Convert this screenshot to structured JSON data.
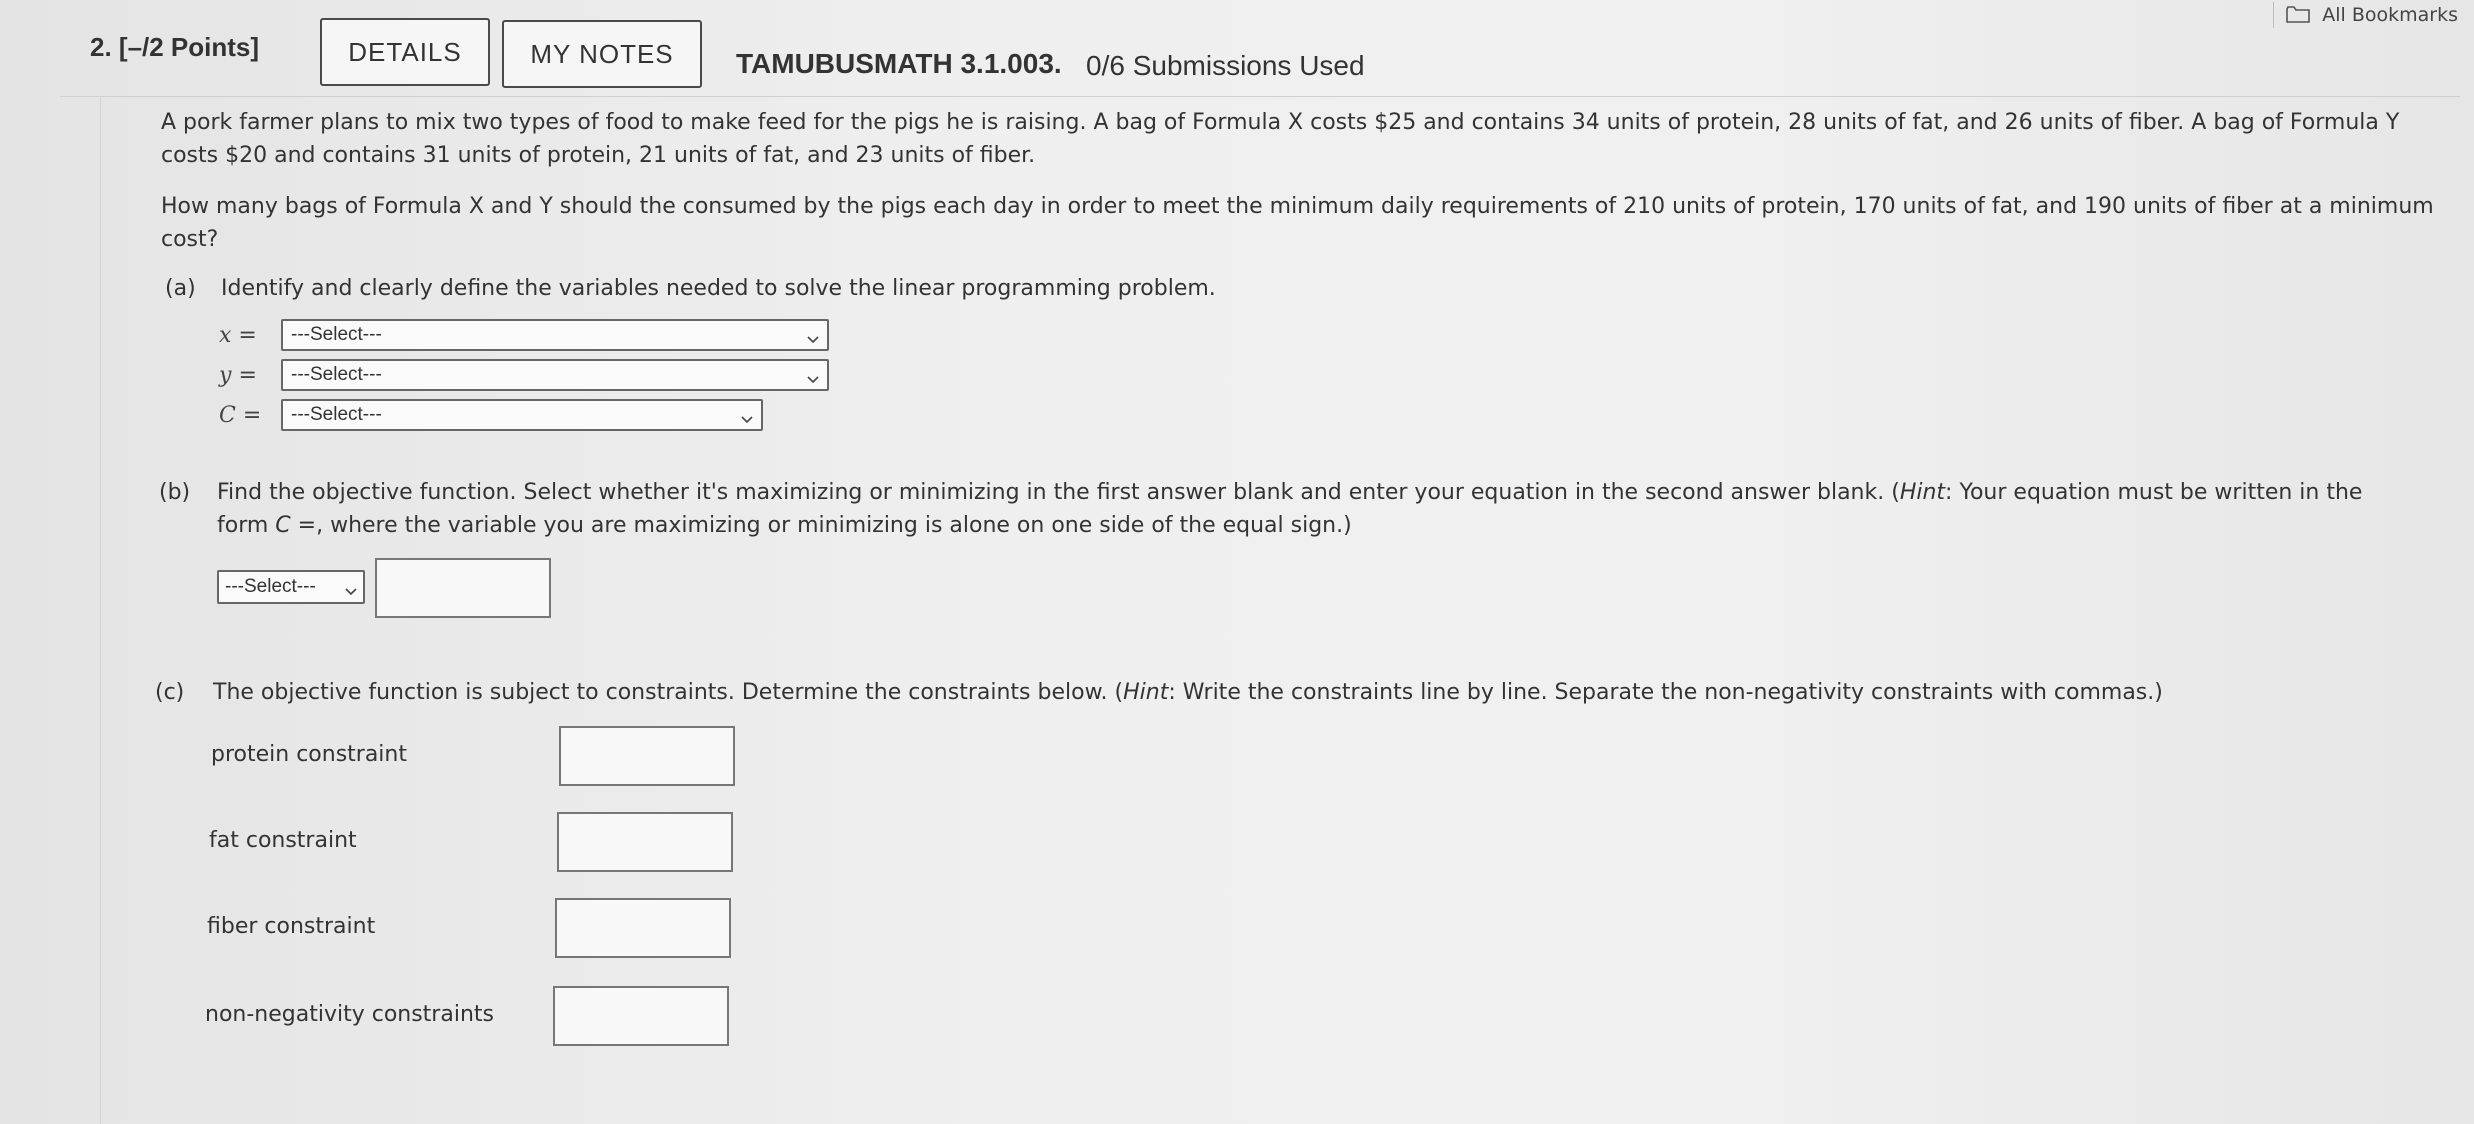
{
  "bookmarks": {
    "label": "All Bookmarks",
    "icon": "folder-icon"
  },
  "header": {
    "question_label": "2.  [–/2 Points]",
    "details_label": "DETAILS",
    "notes_label": "MY NOTES",
    "course_code": "TAMUBUSMATH 3.1.003.",
    "submissions": "0/6 Submissions Used"
  },
  "problem": {
    "paragraph1": "A pork farmer plans to mix two types of food to make feed for the pigs he is raising. A bag of Formula X costs $25 and contains 34 units of protein, 28 units of fat, and 26 units of fiber. A bag of Formula Y costs $20 and contains 31 units of protein, 21 units of fat, and 23 units of fiber.",
    "paragraph2": "How many bags of Formula X and Y should the consumed by the pigs each day in order to meet the minimum daily requirements of 210 units of protein, 170 units of fat, and 190 units of fiber at a minimum cost?"
  },
  "part_a": {
    "tag": "(a)",
    "text": "Identify and clearly define the variables needed to solve the linear programming problem.",
    "vars": [
      {
        "name": "x",
        "eq": "=",
        "selected": "---Select---"
      },
      {
        "name": "y",
        "eq": "=",
        "selected": "---Select---"
      },
      {
        "name": "C",
        "eq": "=",
        "selected": "---Select---"
      }
    ]
  },
  "part_b": {
    "tag": "(b)",
    "text_start": "Find the objective function. Select whether it's maximizing or minimizing in the first answer blank and enter your equation in the second answer blank. (",
    "hint_word": "Hint",
    "text_mid": ": Your equation must be written in the",
    "text_line2_start": "form ",
    "form_expr": "C",
    "text_line2_end": " =, where the variable you are maximizing or minimizing is alone on one side of the equal sign.)",
    "select_value": "---Select---",
    "equation_value": ""
  },
  "part_c": {
    "tag": "(c)",
    "text_start": "The objective function is subject to constraints. Determine the constraints below. (",
    "hint_word": "Hint",
    "text_end": ": Write the constraints line by line. Separate the non-negativity constraints with commas.)",
    "constraints": [
      {
        "label": "protein constraint",
        "value": ""
      },
      {
        "label": "fat constraint",
        "value": ""
      },
      {
        "label": "fiber constraint",
        "value": ""
      },
      {
        "label": "non-negativity constraints",
        "value": ""
      }
    ]
  }
}
